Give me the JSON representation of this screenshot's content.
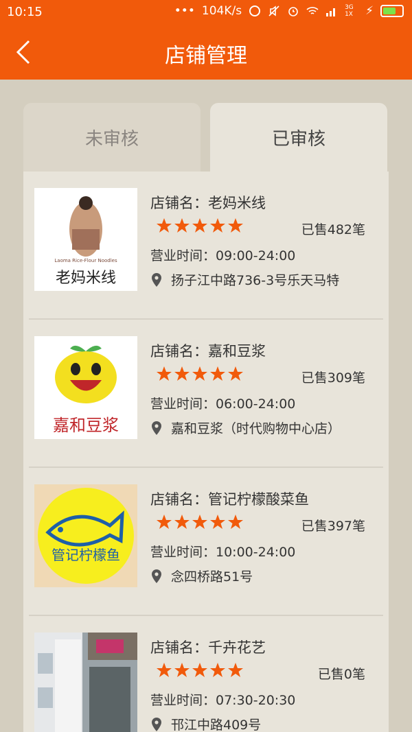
{
  "status": {
    "time": "10:15",
    "network": "104K/s",
    "signal": "3G 1X"
  },
  "header": {
    "title": "店铺管理"
  },
  "tabs": [
    {
      "label": "未审核"
    },
    {
      "label": "已审核"
    }
  ],
  "stores": [
    {
      "name": "店铺名：老妈米线",
      "sold": "已售482笔",
      "hours": "营业时间：09:00-24:00",
      "address": "扬子江中路736-3号乐天马特",
      "logo_text": "老妈米线",
      "logo_sub": "Laoma Rice-Flour Noodles",
      "rating": 5
    },
    {
      "name": "店铺名：嘉和豆浆",
      "sold": "已售309笔",
      "hours": "营业时间：06:00-24:00",
      "address": "嘉和豆浆（时代购物中心店）",
      "logo_text": "嘉和豆浆",
      "rating": 5
    },
    {
      "name": "店铺名：管记柠檬酸菜鱼",
      "sold": "已售397笔",
      "hours": "营业时间：10:00-24:00",
      "address": "念四桥路51号",
      "logo_text": "管记柠檬鱼",
      "rating": 5
    },
    {
      "name": "店铺名：千卉花艺",
      "sold": "已售0笔",
      "hours": "营业时间：07:30-20:30",
      "address": "邗江中路409号",
      "rating": 5
    }
  ],
  "colors": {
    "accent": "#f15a0b",
    "star": "#f15a0b",
    "background": "#d4cebf",
    "card": "#e8e4da"
  }
}
